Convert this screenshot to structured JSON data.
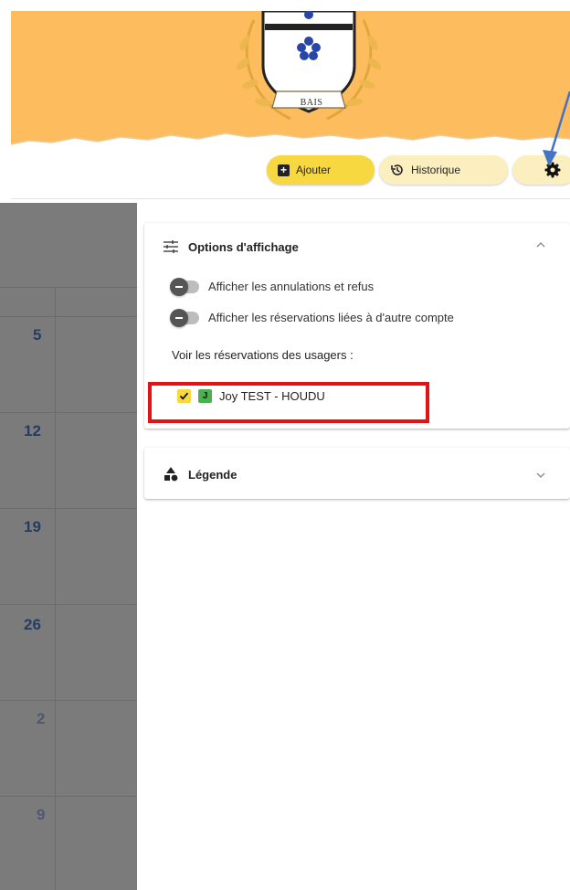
{
  "banner": {
    "crest_label": "BAIS"
  },
  "toolbar": {
    "add_label": "Ajouter",
    "history_label": "Historique"
  },
  "calendar": {
    "days": [
      "5",
      "12",
      "19",
      "26",
      "2",
      "9"
    ]
  },
  "options_panel": {
    "title": "Options d'affichage",
    "toggles": [
      {
        "label": "Afficher les annulations et refus",
        "checked": false
      },
      {
        "label": "Afficher les réservations liées à d'autre compte",
        "checked": false
      }
    ],
    "users_title": "Voir les réservations des usagers :",
    "user": {
      "badge": "J",
      "name": "Joy TEST - HOUDU",
      "checked": true
    }
  },
  "legend_panel": {
    "title": "Légende"
  },
  "colors": {
    "banner": "#fdbd5e",
    "accent_yellow": "#f7d840",
    "pale_yellow": "#fbefc0",
    "badge_green": "#4caf50",
    "highlight_red": "#e01414",
    "pointer_blue": "#4472c4"
  },
  "icons": {
    "add": "plus-square-icon",
    "history": "history-icon",
    "settings": "gear-icon",
    "options": "sliders-icon",
    "legend": "shapes-icon"
  }
}
